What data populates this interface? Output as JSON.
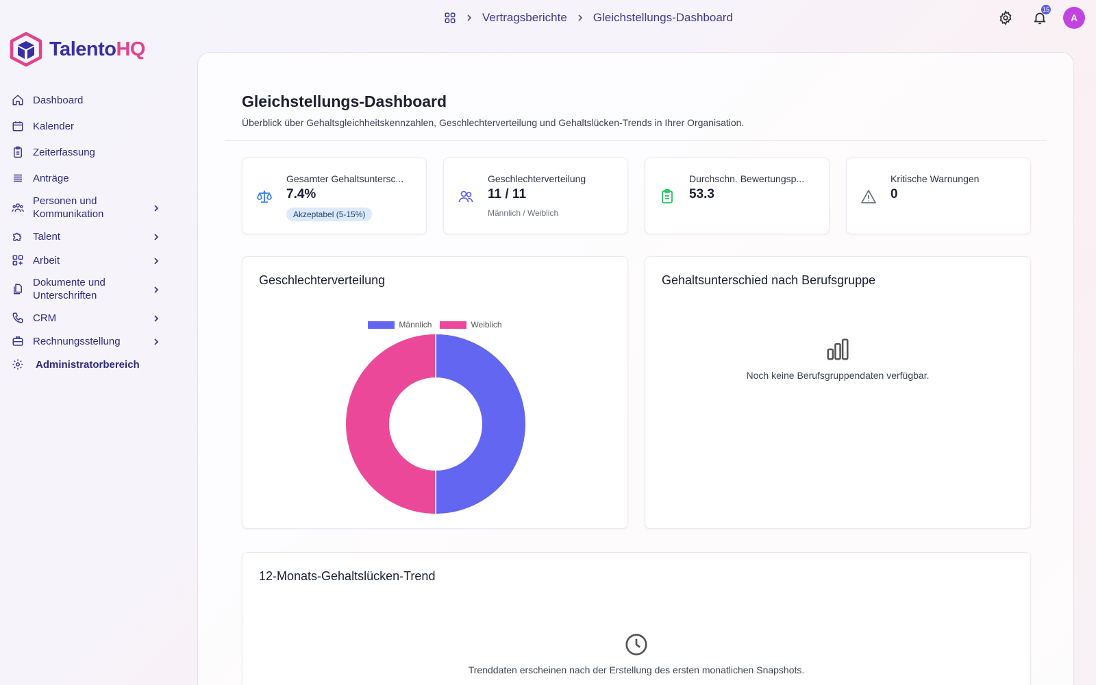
{
  "app": {
    "logo_primary": "Talento",
    "logo_accent": "HQ",
    "brand_color": "#3730a3",
    "accent_color": "#e1438c"
  },
  "sidebar": {
    "items": [
      {
        "label": "Dashboard",
        "icon": "home-icon",
        "has_submenu": false
      },
      {
        "label": "Kalender",
        "icon": "calendar-icon",
        "has_submenu": false
      },
      {
        "label": "Zeiterfassung",
        "icon": "clipboard-icon",
        "has_submenu": false
      },
      {
        "label": "Anträge",
        "icon": "list-icon",
        "has_submenu": false
      },
      {
        "label_line1": "Personen und",
        "label_line2": "Kommunikation",
        "icon": "users-icon",
        "has_submenu": true
      },
      {
        "label": "Talent",
        "icon": "puzzle-icon",
        "has_submenu": true
      },
      {
        "label": "Arbeit",
        "icon": "grid-plus-icon",
        "has_submenu": true
      },
      {
        "label_line1": "Dokumente und",
        "label_line2": "Unterschriften",
        "icon": "documents-icon",
        "has_submenu": true
      },
      {
        "label": "CRM",
        "icon": "phone-icon",
        "has_submenu": true
      },
      {
        "label": "Rechnungsstellung",
        "icon": "briefcase-icon",
        "has_submenu": true
      },
      {
        "label": "Administratorbereich",
        "icon": "gear-icon",
        "has_submenu": false
      }
    ]
  },
  "header": {
    "breadcrumb": [
      "Vertragsberichte",
      "Gleichstellungs-Dashboard"
    ],
    "notification_count": "15",
    "avatar_initial": "A"
  },
  "page": {
    "title": "Gleichstellungs-Dashboard",
    "subtitle": "Überblick über Gehaltsgleichheitskennzahlen, Geschlechterverteilung und Gehaltslücken-Trends in Ihrer Organisation."
  },
  "stats": [
    {
      "label": "Gesamter Gehaltsuntersc...",
      "value": "7.4%",
      "pill": "Akzeptabel (5-15%)",
      "icon": "scale-icon",
      "icon_color": "#3b82f6"
    },
    {
      "label": "Geschlechterverteilung",
      "value": "11 / 11",
      "note": "Männlich / Weiblich",
      "icon": "users-icon",
      "icon_color": "#6366f1"
    },
    {
      "label": "Durchschn. Bewertungsp...",
      "value": "53.3",
      "icon": "clipboard-check-icon",
      "icon_color": "#22c55e"
    },
    {
      "label": "Kritische Warnungen",
      "value": "0",
      "icon": "warning-icon",
      "icon_color": "#6b7280"
    }
  ],
  "gender_card": {
    "title": "Geschlechterverteilung"
  },
  "chart_data": {
    "type": "pie",
    "variant": "doughnut",
    "labels": [
      "Männlich",
      "Weiblich"
    ],
    "values": [
      11,
      11
    ],
    "colors": [
      "#6366f1",
      "#ec4899"
    ],
    "legend": "top"
  },
  "job_group_card": {
    "title": "Gehaltsunterschied nach Berufsgruppe",
    "empty_text": "Noch keine Berufsgruppendaten verfügbar.",
    "icon": "bar-chart-icon"
  },
  "trend_card": {
    "title": "12-Monats-Gehaltslücken-Trend",
    "empty_text": "Trenddaten erscheinen nach der Erstellung des ersten monatlichen Snapshots.",
    "icon": "clock-icon"
  }
}
